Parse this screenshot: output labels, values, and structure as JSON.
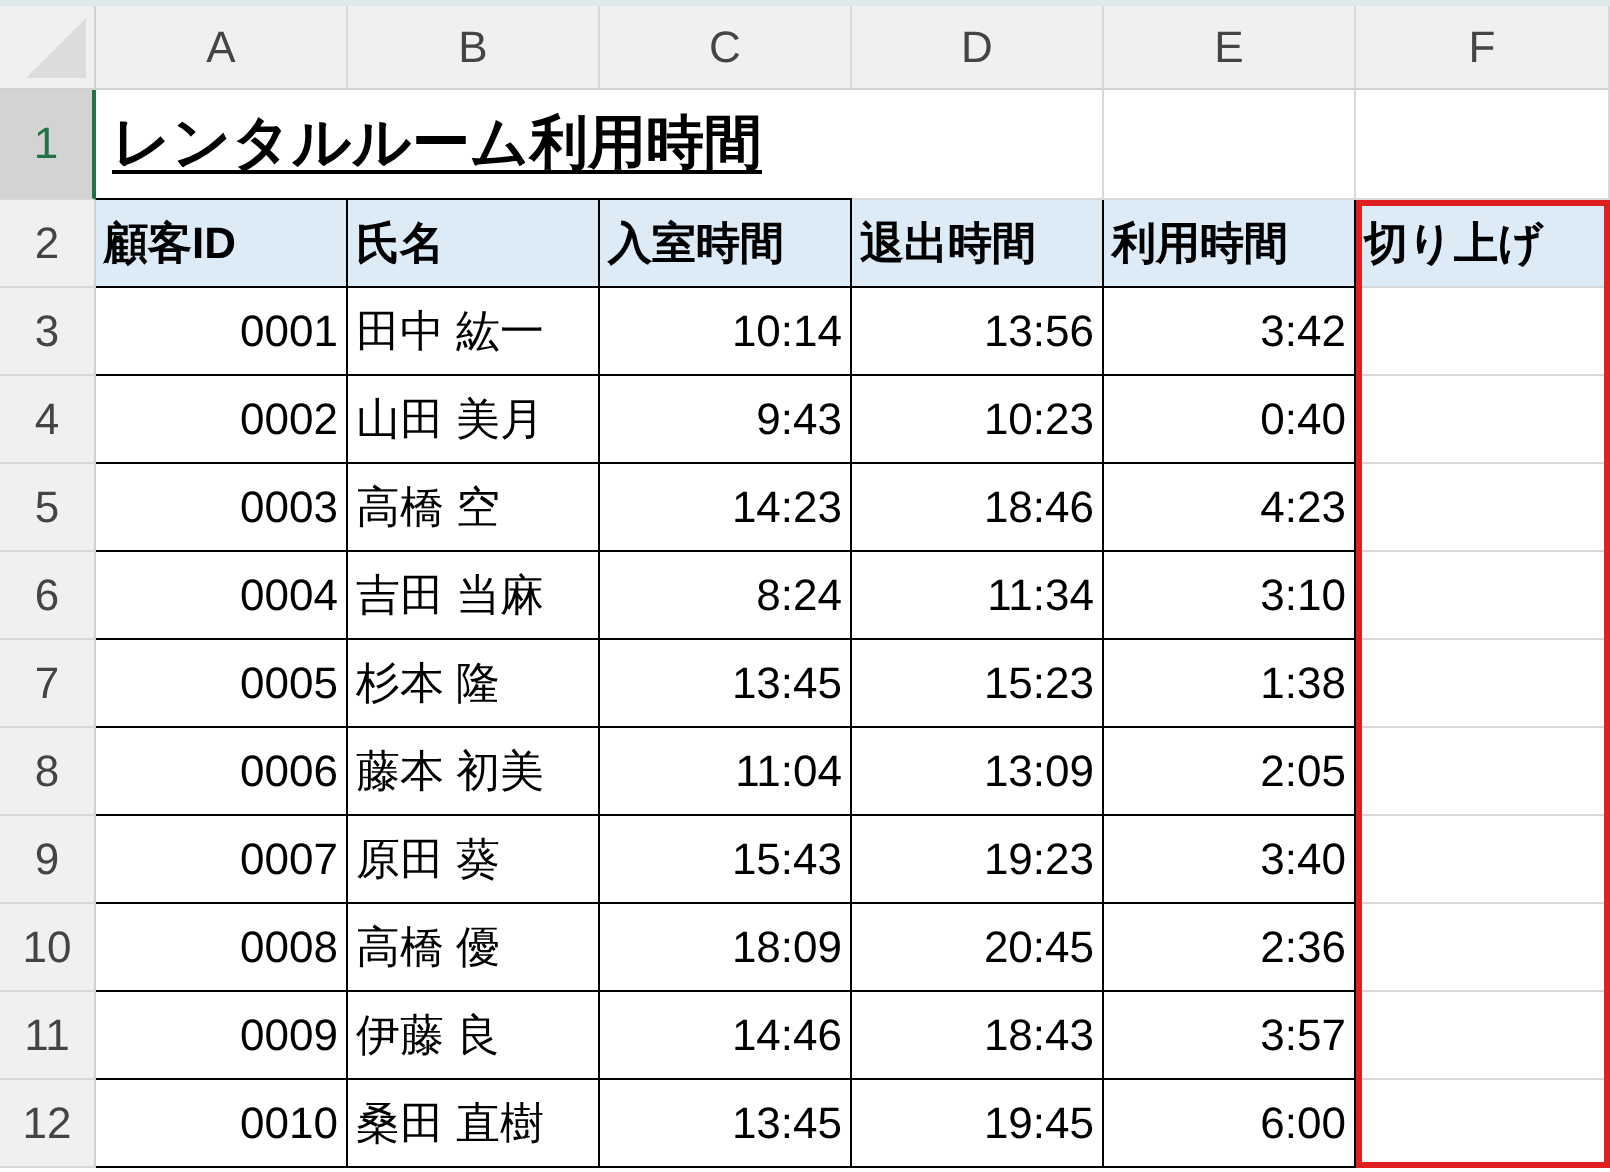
{
  "column_headers": [
    {
      "label": "A",
      "selected": false
    },
    {
      "label": "B",
      "selected": false
    },
    {
      "label": "C",
      "selected": false
    },
    {
      "label": "D",
      "selected": false
    },
    {
      "label": "E",
      "selected": false
    },
    {
      "label": "F",
      "selected": false
    }
  ],
  "row_headers": [
    {
      "label": "1",
      "selected": true
    },
    {
      "label": "2",
      "selected": false
    },
    {
      "label": "3",
      "selected": false
    },
    {
      "label": "4",
      "selected": false
    },
    {
      "label": "5",
      "selected": false
    },
    {
      "label": "6",
      "selected": false
    },
    {
      "label": "7",
      "selected": false
    },
    {
      "label": "8",
      "selected": false
    },
    {
      "label": "9",
      "selected": false
    },
    {
      "label": "10",
      "selected": false
    },
    {
      "label": "11",
      "selected": false
    },
    {
      "label": "12",
      "selected": false
    }
  ],
  "title": "レンタルルーム利用時間",
  "table": {
    "columns": [
      {
        "label": "顧客ID",
        "highlighted": false
      },
      {
        "label": "氏名",
        "highlighted": false
      },
      {
        "label": "入室時間",
        "highlighted": false
      },
      {
        "label": "退出時間",
        "highlighted": false
      },
      {
        "label": "利用時間",
        "highlighted": false
      },
      {
        "label": "切り上げ",
        "highlighted": true
      }
    ],
    "rows": [
      [
        "0001",
        "田中 紘一",
        "10:14",
        "13:56",
        "3:42"
      ],
      [
        "0002",
        "山田 美月",
        "9:43",
        "10:23",
        "0:40"
      ],
      [
        "0003",
        "高橋 空",
        "14:23",
        "18:46",
        "4:23"
      ],
      [
        "0004",
        "吉田 当麻",
        "8:24",
        "11:34",
        "3:10"
      ],
      [
        "0005",
        "杉本 隆",
        "13:45",
        "15:23",
        "1:38"
      ],
      [
        "0006",
        "藤本 初美",
        "11:04",
        "13:09",
        "2:05"
      ],
      [
        "0007",
        "原田 葵",
        "15:43",
        "19:23",
        "3:40"
      ],
      [
        "0008",
        "高橋 優",
        "18:09",
        "20:45",
        "2:36"
      ],
      [
        "0009",
        "伊藤 良",
        "14:46",
        "18:43",
        "3:57"
      ],
      [
        "0010",
        "桑田 直樹",
        "13:45",
        "19:45",
        "6:00"
      ]
    ]
  }
}
